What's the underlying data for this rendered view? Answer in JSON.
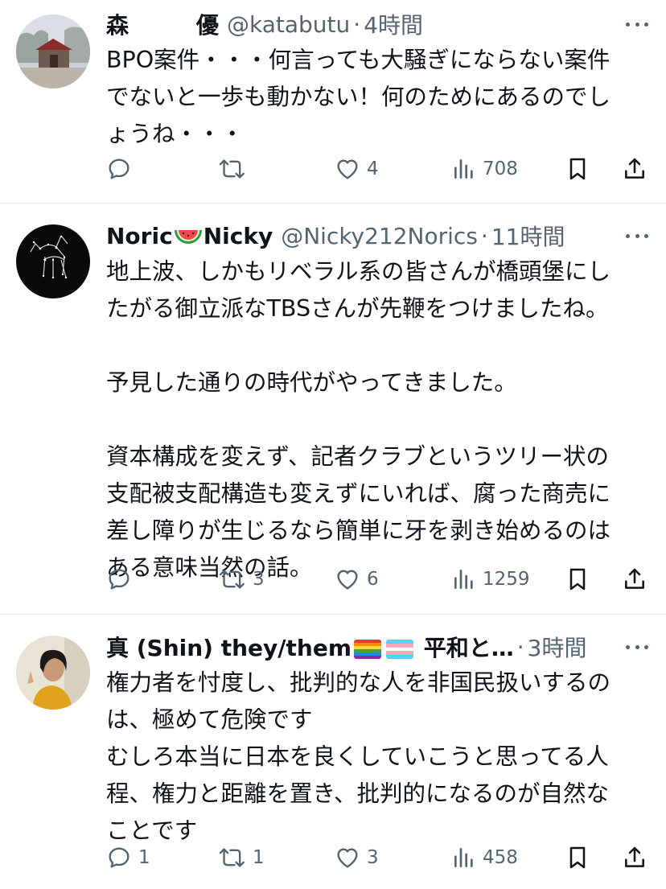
{
  "tweets": [
    {
      "name": "森　　　優",
      "handle": "@katabutu",
      "time": "4時間",
      "text": "BPO案件・・・何言っても大騒ぎにならない案件\nでないと一歩も動かない！何のためにあるのでし\nょうね・・・",
      "replies": "",
      "retweets": "",
      "likes": "4",
      "views": "708"
    },
    {
      "name_part1": "Noric",
      "name_emoji": "watermelon-emoji",
      "name_part2": "Nicky",
      "handle": "@Nicky212Norics",
      "time": "11時間",
      "text": "地上波、しかもリベラル系の皆さんが橋頭堡にし\nたがる御立派なTBSさんが先鞭をつけましたね。\n\n予見した通りの時代がやってきました。\n\n資本構成を変えず、記者クラブというツリー状の\n支配被支配構造も変えずにいれば、腐った商売に\n差し障りが生じるなら簡単に牙を剥き始めるのは\nある意味当然の話。",
      "replies": "",
      "retweets": "3",
      "likes": "6",
      "views": "1259"
    },
    {
      "name_part1": "真 (Shin) they/them",
      "name_flags": [
        "rainbow-flag-emoji",
        "transgender-flag-emoji"
      ],
      "name_part2": "平和と…",
      "handle": "",
      "time": "3時間",
      "text": "権力者を忖度し、批判的な人を非国民扱いするの\nは、極めて危険です\nむしろ本当に日本を良くしていこうと思ってる人\n程、権力と距離を置き、批判的になるのが自然な\nことです",
      "replies": "1",
      "retweets": "1",
      "likes": "3",
      "views": "458"
    }
  ],
  "separator_dot": "·",
  "colors": {
    "text": "#0f1419",
    "secondary": "#536471",
    "divider": "#e6e9ec"
  }
}
